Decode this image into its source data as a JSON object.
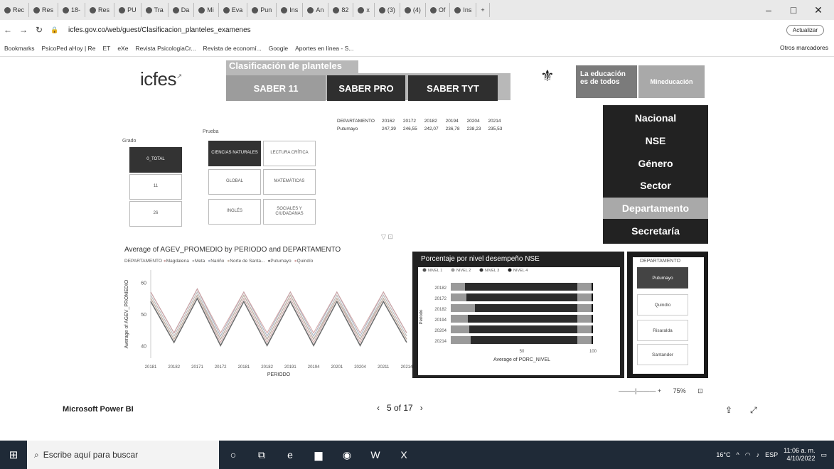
{
  "browser": {
    "tabs": [
      "Rec",
      "Res",
      "18-",
      "Res",
      "PU",
      "Tra",
      "Da",
      "Mi",
      "Eva",
      "Pun",
      "Ins",
      "An",
      "82",
      "x",
      "(3)",
      "(4)",
      "Of",
      "Ins"
    ],
    "url": "icfes.gov.co/web/guest/Clasificacion_planteles_examenes",
    "update_label": "Actualizar",
    "bookmarks": [
      "Bookmarks",
      "PsicoPed aHoy | Re",
      "ET",
      "eXe",
      "Revista PsicologiaCr...",
      "Revista de economí...",
      "Google",
      "Aportes en línea - S..."
    ],
    "other_bookmarks": "Otros marcadores",
    "tab_close": "x",
    "new_tab": "+"
  },
  "header": {
    "logo": "icfes",
    "section_title": "Clasificación de planteles",
    "tabs": [
      "SABER 11",
      "SABER PRO",
      "SABER TYT"
    ],
    "edu_badge": "La educación es de todos",
    "ministry": "Mineducación"
  },
  "side_menu": [
    "Nacional",
    "NSE",
    "Género",
    "Sector",
    "Departamento",
    "Secretaría"
  ],
  "filters": {
    "grado_label": "Grado",
    "prueba_label": "Prueba",
    "grados": [
      "0_TOTAL",
      "11",
      "26"
    ],
    "pruebas": [
      "CIENCIAS NATURALES",
      "LECTURA CRÍTICA",
      "GLOBAL",
      "MATEMÁTICAS",
      "INGLÉS",
      "SOCIALES Y CIUDADANAS"
    ]
  },
  "dept_table": {
    "headers": [
      "DEPARTAMENTO",
      "20162",
      "20172",
      "20182",
      "20194",
      "20204",
      "20214"
    ],
    "row": [
      "Putumayo",
      "247,39",
      "246,55",
      "242,07",
      "236,78",
      "238,23",
      "235,53"
    ]
  },
  "line_chart": {
    "title": "Average of AGEV_PROMEDIO by PERIODO and DEPARTAMENTO",
    "legend_title": "DEPARTAMENTO",
    "legend_items": [
      "Magdalena",
      "Meta",
      "Nariño",
      "Norte de Santa...",
      "Putumayo",
      "Quindío"
    ],
    "ylabel": "Average of AGEV_PROMEDIO",
    "xlabel": "PERIODO",
    "y_ticks": [
      "60",
      "50",
      "40"
    ],
    "x_ticks": [
      "20181",
      "20182",
      "20171",
      "20172",
      "20181",
      "20182",
      "20191",
      "20194",
      "20201",
      "20204",
      "20211",
      "20214"
    ]
  },
  "nse_chart": {
    "title": "Porcentaje por nivel desempeño NSE",
    "legend": [
      "NIVEL 1",
      "NIVEL 2",
      "NIVEL 3",
      "NIVEL 4"
    ],
    "ylabel": "Periodo",
    "xlabel": "Average of PORC_NIVEL",
    "periods": [
      "20182",
      "20172",
      "20182",
      "20194",
      "20204",
      "20214"
    ],
    "x_ticks": [
      "50",
      "100"
    ]
  },
  "dept_slicer": {
    "title": "DEPARTAMENTO",
    "items": [
      "Putumayo",
      "Quindío",
      "Risaralda",
      "Santander"
    ]
  },
  "zoom_level": "75%",
  "footer": {
    "product": "Microsoft Power BI",
    "page_indicator": "5 of 17"
  },
  "taskbar": {
    "search_placeholder": "Escribe aquí para buscar",
    "weather": "16°C",
    "lang": "ESP",
    "time": "11:06 a. m.",
    "date": "4/10/2022"
  },
  "chart_data": [
    {
      "type": "line",
      "title": "Average of AGEV_PROMEDIO by PERIODO and DEPARTAMENTO",
      "xlabel": "PERIODO",
      "ylabel": "Average of AGEV_PROMEDIO",
      "categories": [
        "20181",
        "20182",
        "20171",
        "20172",
        "20181",
        "20182",
        "20191",
        "20194",
        "20201",
        "20204",
        "20211",
        "20214"
      ],
      "ylim": [
        36,
        64
      ],
      "series": [
        {
          "name": "Magdalena",
          "values": [
            55,
            42,
            56,
            41,
            55,
            41,
            55,
            41,
            55,
            41,
            55,
            42
          ]
        },
        {
          "name": "Meta",
          "values": [
            56,
            43,
            57,
            42,
            56,
            42,
            56,
            42,
            56,
            42,
            56,
            43
          ]
        },
        {
          "name": "Nariño",
          "values": [
            57,
            44,
            58,
            43,
            57,
            43,
            57,
            43,
            57,
            43,
            57,
            44
          ]
        },
        {
          "name": "Norte de Santa...",
          "values": [
            55,
            42,
            56,
            42,
            56,
            42,
            56,
            42,
            55,
            42,
            55,
            42
          ]
        },
        {
          "name": "Putumayo",
          "values": [
            54,
            41,
            55,
            40,
            54,
            40,
            54,
            40,
            54,
            40,
            54,
            41
          ]
        },
        {
          "name": "Quindío",
          "values": [
            57,
            44,
            58,
            44,
            57,
            44,
            57,
            44,
            57,
            44,
            57,
            44
          ]
        }
      ]
    },
    {
      "type": "bar",
      "title": "Porcentaje por nivel desempeño NSE",
      "xlabel": "Average of PORC_NIVEL",
      "ylabel": "Periodo",
      "categories": [
        "20182",
        "20172",
        "20182",
        "20194",
        "20204",
        "20214"
      ],
      "stacked": true,
      "orientation": "horizontal",
      "xlim": [
        0,
        100
      ],
      "series": [
        {
          "name": "NIVEL 1",
          "values": [
            10,
            11,
            17,
            12,
            13,
            14
          ]
        },
        {
          "name": "NIVEL 2",
          "values": [
            79,
            78,
            72,
            77,
            76,
            75
          ]
        },
        {
          "name": "NIVEL 3",
          "values": [
            10,
            10,
            10,
            10,
            10,
            10
          ]
        },
        {
          "name": "NIVEL 4",
          "values": [
            1,
            1,
            1,
            1,
            1,
            1
          ]
        }
      ]
    }
  ]
}
